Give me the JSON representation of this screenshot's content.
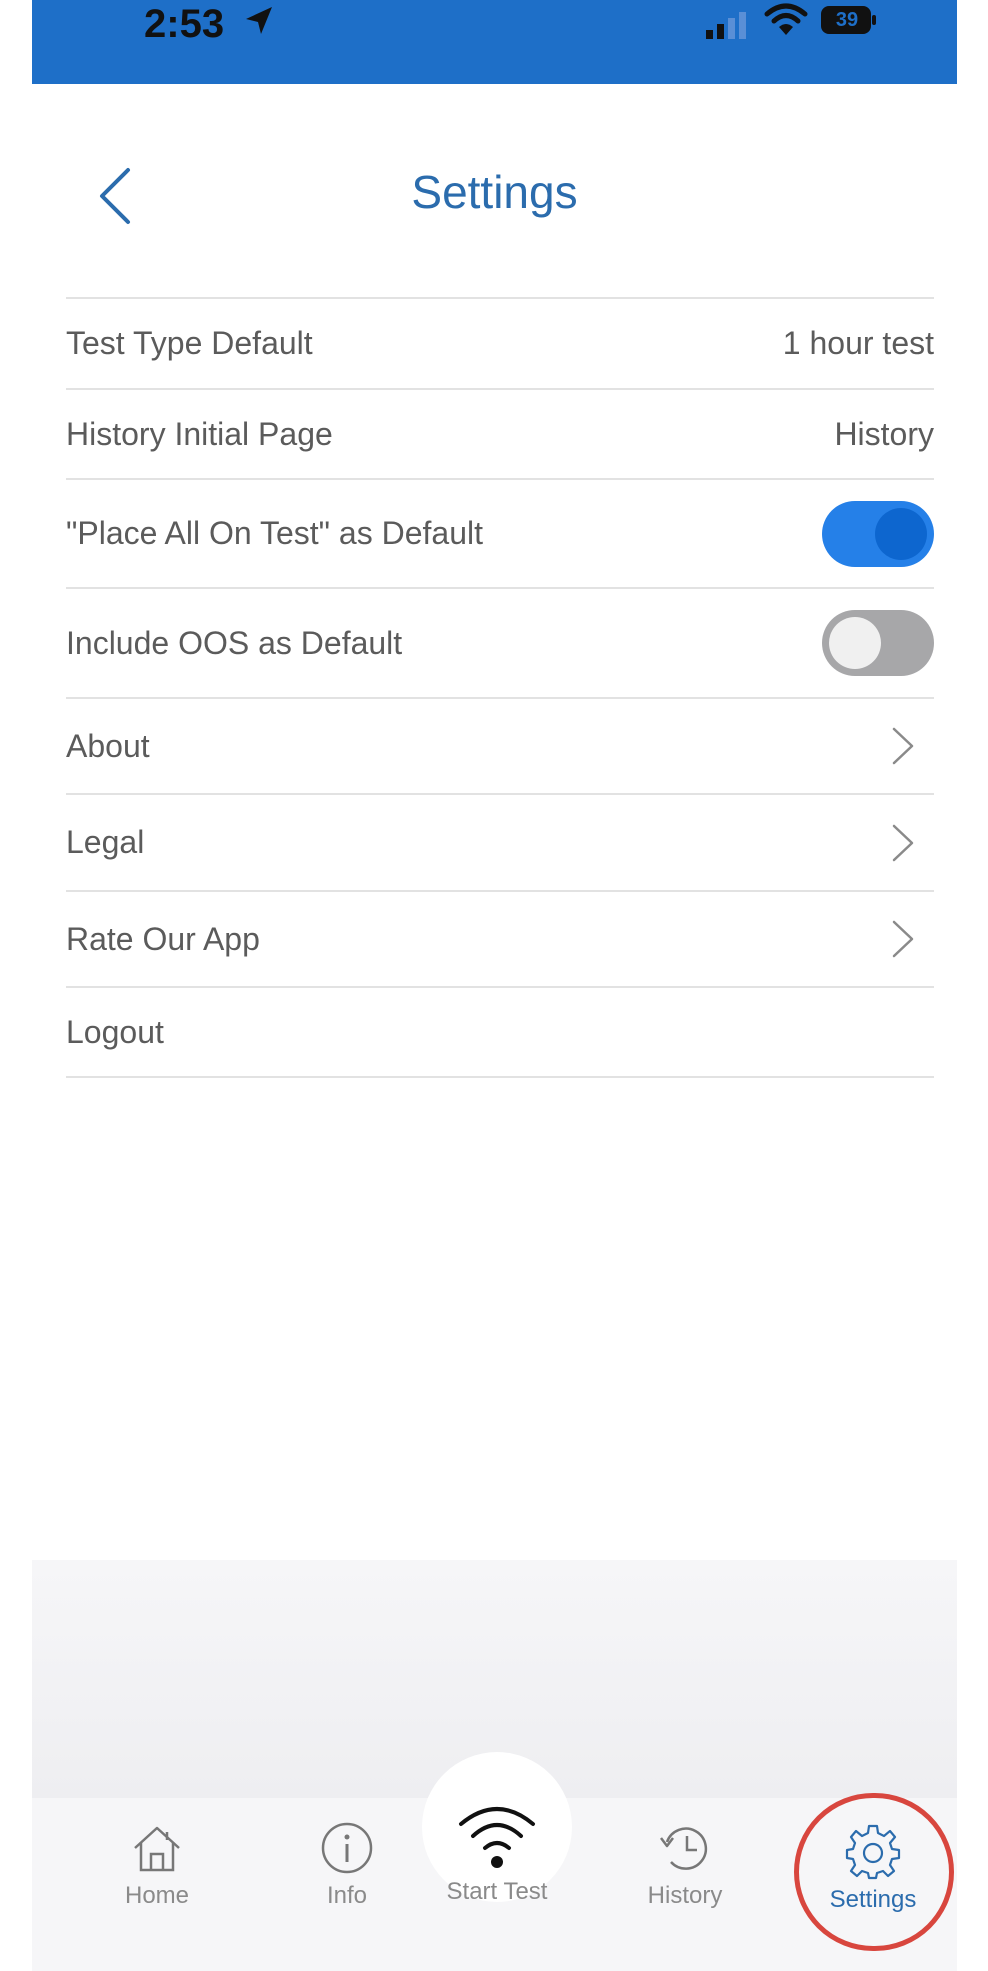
{
  "status_bar": {
    "time": "2:53",
    "battery": "39",
    "background_color": "#1e6fc8"
  },
  "header": {
    "title": "Settings",
    "back_icon": "chevron-left-icon"
  },
  "settings": {
    "test_type_default": {
      "label": "Test Type Default",
      "value": "1 hour test"
    },
    "history_initial_page": {
      "label": "History Initial Page",
      "value": "History"
    },
    "place_all_on_test": {
      "label": "\"Place All On Test\" as Default",
      "enabled": true
    },
    "include_oos": {
      "label": "Include OOS as Default",
      "enabled": false
    },
    "about": {
      "label": "About"
    },
    "legal": {
      "label": "Legal"
    },
    "rate_app": {
      "label": "Rate Our App"
    },
    "logout": {
      "label": "Logout"
    }
  },
  "tab_bar": {
    "tabs": [
      {
        "label": "Home",
        "icon": "home-icon",
        "active": false
      },
      {
        "label": "Info",
        "icon": "info-icon",
        "active": false
      },
      {
        "label": "Start Test",
        "icon": "wifi-icon",
        "active": false
      },
      {
        "label": "History",
        "icon": "history-icon",
        "active": false
      },
      {
        "label": "Settings",
        "icon": "gear-icon",
        "active": true
      }
    ]
  },
  "colors": {
    "accent": "#2b6cad",
    "toggle_on": "#2580e8",
    "highlight_circle": "#d8463e"
  }
}
